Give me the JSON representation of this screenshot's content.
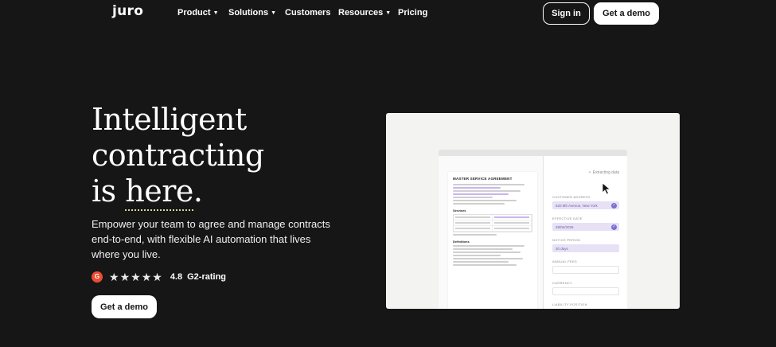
{
  "nav": {
    "logo": "juro",
    "items": [
      {
        "label": "Product",
        "dropdown": true
      },
      {
        "label": "Solutions",
        "dropdown": true
      },
      {
        "label": "Customers",
        "dropdown": false
      },
      {
        "label": "Resources",
        "dropdown": true
      },
      {
        "label": "Pricing",
        "dropdown": false
      }
    ],
    "signin_label": "Sign in",
    "demo_label": "Get a demo"
  },
  "hero": {
    "headline_line1": "Intelligent",
    "headline_line2": "contracting",
    "headline_line3_prefix": "is ",
    "headline_line3_highlight": "here",
    "headline_line3_suffix": ".",
    "subtext": "Empower your team to agree and manage contracts end-to-end, with flexible AI automation that lives where you live.",
    "rating_icon": "G",
    "rating_stars": 5,
    "rating_value": "4.8",
    "rating_label": "G2-rating",
    "cta_label": "Get a demo"
  },
  "product_visual": {
    "doc_title": "MASTER SERVICE AGREEMENT",
    "doc_section_services": "Services",
    "doc_section_definitions": "Definitions",
    "extracting_label": "Extracting data",
    "fields": [
      {
        "label": "CUSTOMER ADDRESS",
        "value": "520 8th Avenue, New York",
        "filled": true
      },
      {
        "label": "EFFECTIVE DATE",
        "value": "28/04/2025",
        "filled": true
      },
      {
        "label": "NOTICE PERIOD",
        "value": "30 days",
        "filled": true
      },
      {
        "label": "ANNUAL FEES",
        "value": "",
        "filled": false
      },
      {
        "label": "CURRENCY",
        "value": "",
        "filled": false
      },
      {
        "label": "LIABILITY POSITION",
        "value": "",
        "filled": false
      }
    ]
  },
  "colors": {
    "background": "#161616",
    "highlight": "#c9b5f0",
    "g2": "#ef4b33",
    "underline": "#d7d79a"
  }
}
